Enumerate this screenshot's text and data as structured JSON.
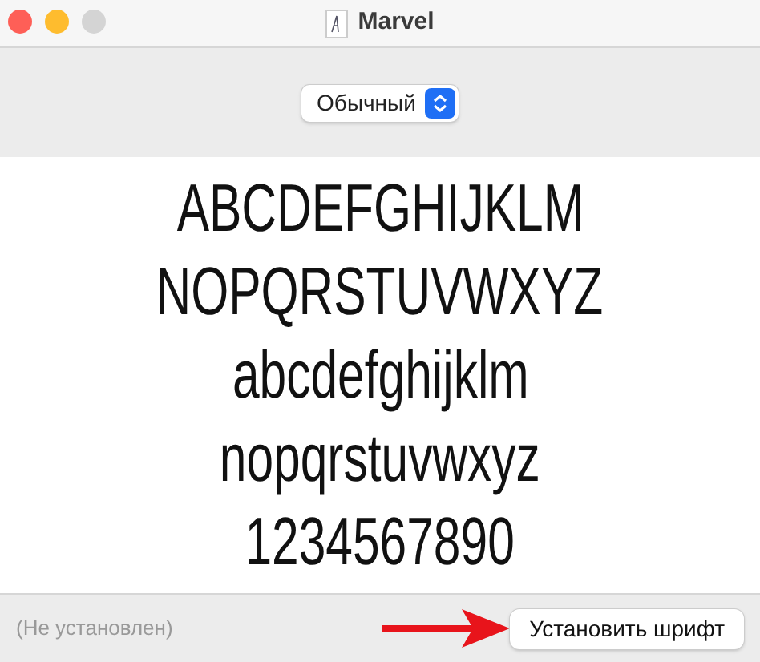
{
  "window": {
    "title": "Marvel"
  },
  "style_select": {
    "value": "Обычный"
  },
  "preview_lines": [
    "ABCDEFGHIJKLM",
    "NOPQRSTUVWXYZ",
    "abcdefghijklm",
    "nopqrstuvwxyz",
    "1234567890"
  ],
  "status_bar": {
    "status": "(Не установлен)",
    "install_button": "Установить шрифт"
  }
}
